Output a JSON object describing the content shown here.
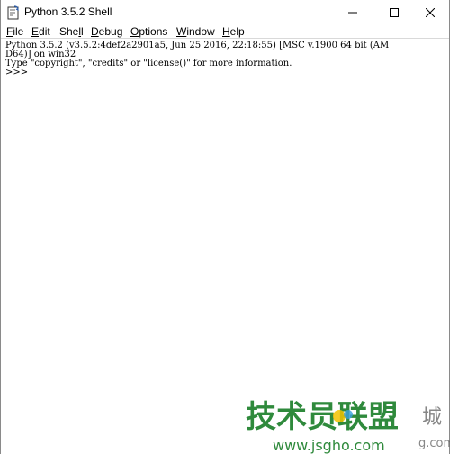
{
  "window": {
    "title": "Python 3.5.2 Shell"
  },
  "menu": [
    {
      "label": "File",
      "acc": "F",
      "rest": "ile"
    },
    {
      "label": "Edit",
      "acc": "E",
      "rest": "dit"
    },
    {
      "label": "Shell",
      "pre": "She",
      "acc": "l",
      "rest": "l"
    },
    {
      "label": "Debug",
      "acc": "D",
      "rest": "ebug"
    },
    {
      "label": "Options",
      "acc": "O",
      "rest": "ptions"
    },
    {
      "label": "Window",
      "acc": "W",
      "rest": "indow"
    },
    {
      "label": "Help",
      "acc": "H",
      "rest": "elp"
    }
  ],
  "shell": {
    "line1": "Python 3.5.2 (v3.5.2:4def2a2901a5, Jun 25 2016, 22:18:55) [MSC v.1900 64 bit (AM",
    "line2": "D64)] on win32",
    "line3": "Type \"copyright\", \"credits\" or \"license()\" for more information.",
    "prompt": ">>> "
  },
  "watermark": {
    "title": "技术员联盟",
    "site": "www.jsgho.com",
    "extra": "城",
    "extra_site": "g.com"
  },
  "colors": {
    "watermark_green": "#2f8a3c",
    "close_hover": "#e81123"
  }
}
